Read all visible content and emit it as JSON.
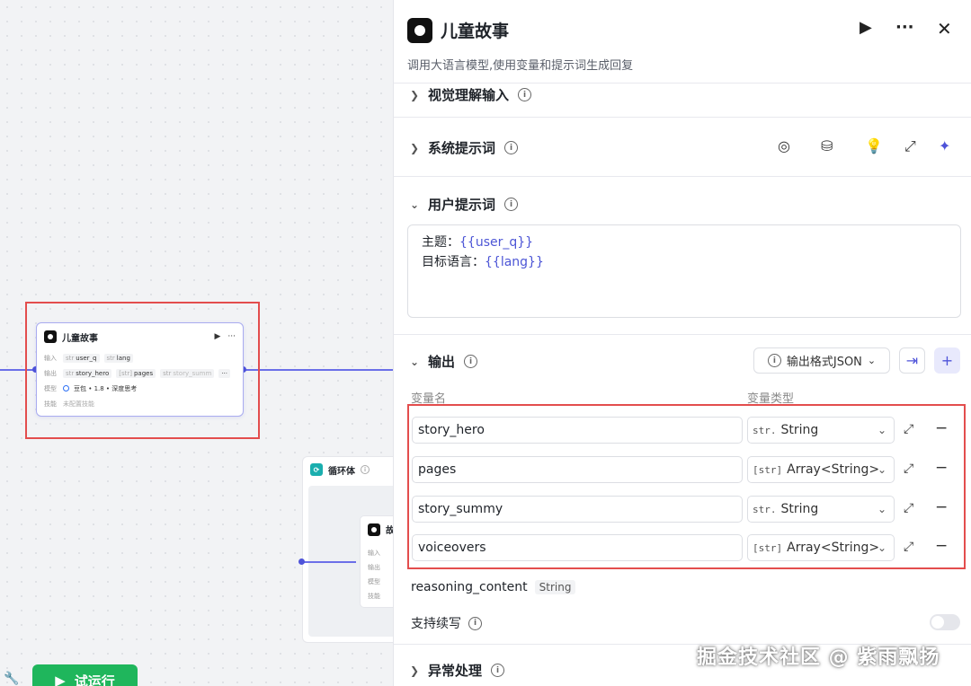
{
  "canvas": {
    "node": {
      "title": "儿童故事",
      "input_label": "输入",
      "output_label": "输出",
      "model_label": "模型",
      "skill_label": "技能",
      "inputs": [
        {
          "type": "str",
          "name": "user_q"
        },
        {
          "type": "str",
          "name": "lang"
        }
      ],
      "outputs": [
        {
          "type": "str",
          "name": "story_hero"
        },
        {
          "type": "[str]",
          "name": "pages"
        },
        {
          "type": "str",
          "name": "story_summ"
        }
      ],
      "model": "豆包 • 1.8 • 深度思考",
      "skill": "未配置技能"
    },
    "loop": {
      "title": "循环体",
      "inner_title": "故",
      "inner_labels": [
        "输入",
        "输出",
        "模型",
        "技能"
      ]
    },
    "run_button": "试运行"
  },
  "panel": {
    "title": "儿童故事",
    "description": "调用大语言模型,使用变量和提示词生成回复",
    "sections": {
      "vision": "视觉理解输入",
      "system_prompt": "系统提示词",
      "user_prompt": "用户提示词",
      "output": "输出",
      "error": "异常处理"
    },
    "user_prompt": {
      "line1_label": "主题：",
      "line1_var": "{{user_q}}",
      "line2_label": "目标语言：",
      "line2_var": "{{lang}}"
    },
    "output": {
      "format_label": "输出格式JSON",
      "col_name": "变量名",
      "col_type": "变量类型",
      "rows": [
        {
          "name": "story_hero",
          "type_icon": "str.",
          "type": "String"
        },
        {
          "name": "pages",
          "type_icon": "[str]",
          "type": "Array<String>"
        },
        {
          "name": "story_summy",
          "type_icon": "str.",
          "type": "String"
        },
        {
          "name": "voiceovers",
          "type_icon": "[str]",
          "type": "Array<String>"
        }
      ],
      "reasoning": "reasoning_content",
      "reasoning_type": "String",
      "continue_label": "支持续写"
    }
  },
  "watermark": "掘金技术社区 @ 紫雨飘扬",
  "colors": {
    "accent": "#4e53d9",
    "highlight": "#e34d4d",
    "run": "#1fb65c"
  }
}
